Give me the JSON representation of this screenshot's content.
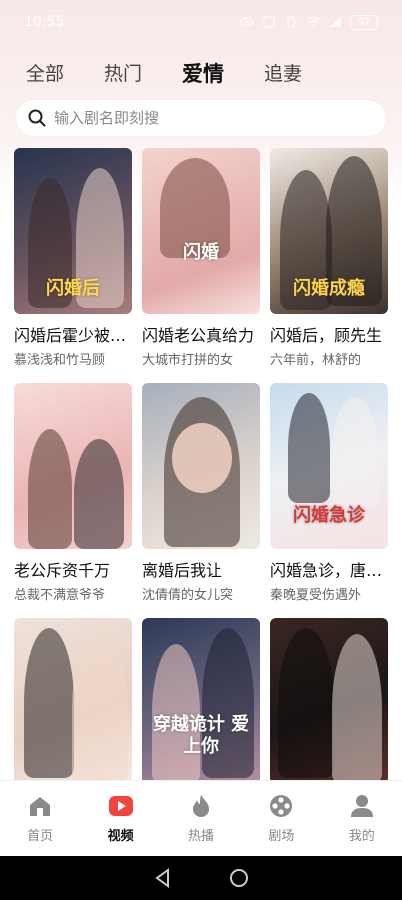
{
  "status_bar": {
    "time": "10:55",
    "battery": "97"
  },
  "tabs": [
    {
      "label": "全部"
    },
    {
      "label": "热门"
    },
    {
      "label": "爱情"
    },
    {
      "label": "追妻"
    }
  ],
  "search": {
    "placeholder": "输入剧名即刻搜"
  },
  "dramas": [
    {
      "title": "闪婚后霍少被宠哭了",
      "desc": "慕浅浅和竹马顾",
      "poster_text": "闪婚后",
      "colors": [
        "#2b3a5a",
        "#8f6a70"
      ]
    },
    {
      "title": "闪婚老公真给力",
      "desc": "大城市打拼的女",
      "poster_text": "闪婚",
      "colors": [
        "#e8b7b5",
        "#f6d6d2"
      ]
    },
    {
      "title": "闪婚后，顾先生",
      "desc": "六年前，林舒的",
      "poster_text": "闪婚成瘾",
      "colors": [
        "#3a3230",
        "#9b7e68"
      ]
    },
    {
      "title": "老公斥资千万",
      "desc": "总裁不满意爷爷",
      "poster_text": "",
      "colors": [
        "#f2c9c8",
        "#e9b2b8"
      ]
    },
    {
      "title": "离婚后我让",
      "desc": "沈倩倩的女儿突",
      "poster_text": "",
      "colors": [
        "#9aa3b3",
        "#e6e0da"
      ]
    },
    {
      "title": "闪婚急诊，唐医生",
      "desc": "秦晚夏受伤遇外",
      "poster_text": "闪婚急诊",
      "colors": [
        "#cfe0ee",
        "#f3e6e6"
      ]
    },
    {
      "title": "",
      "desc": "",
      "poster_text": "",
      "colors": [
        "#e6d6cf",
        "#f5ece6"
      ]
    },
    {
      "title": "",
      "desc": "",
      "poster_text": "穿越诡计 爱上你",
      "colors": [
        "#243047",
        "#7b6f86"
      ]
    },
    {
      "title": "",
      "desc": "",
      "poster_text": "",
      "colors": [
        "#1e1a1a",
        "#5a2f2b"
      ]
    }
  ],
  "bottom_nav": [
    {
      "label": "首页",
      "icon": "home-icon"
    },
    {
      "label": "视频",
      "icon": "video-play-icon"
    },
    {
      "label": "热播",
      "icon": "flame-icon"
    },
    {
      "label": "剧场",
      "icon": "film-reel-icon"
    },
    {
      "label": "我的",
      "icon": "user-icon"
    }
  ],
  "accent_color": "#f0443d"
}
